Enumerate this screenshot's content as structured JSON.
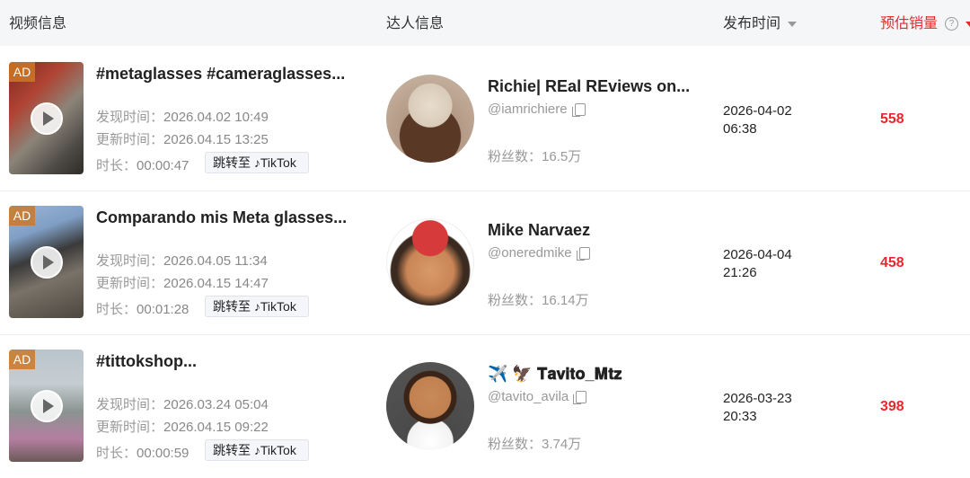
{
  "header": {
    "video_info": "视频信息",
    "creator_info": "达人信息",
    "publish_time": "发布时间",
    "est_sales": "预估销量"
  },
  "labels": {
    "found_prefix": "发现时间：",
    "updated_prefix": "更新时间：",
    "duration_prefix": "时长：",
    "jump_to": "跳转至",
    "tiktok": "TikTok",
    "fans_prefix": "粉丝数：",
    "ad": "AD"
  },
  "rows": [
    {
      "title": "#metaglasses #cameraglasses...",
      "found": "2026.04.02 10:49",
      "updated": "2026.04.15 13:25",
      "duration": "00:00:47",
      "creator_name": "Richie| REal REviews on...",
      "handle": "@iamrichiere",
      "fans": "16.5万",
      "pub_date": "2026-04-02",
      "pub_time": "06:38",
      "sales": "558"
    },
    {
      "title": "Comparando mis Meta glasses...",
      "found": "2026.04.05 11:34",
      "updated": "2026.04.15 14:47",
      "duration": "00:01:28",
      "creator_name": "Mike Narvaez",
      "handle": "@oneredmike",
      "fans": "16.14万",
      "pub_date": "2026-04-04",
      "pub_time": "21:26",
      "sales": "458"
    },
    {
      "title": "#tittokshop...",
      "found": "2026.03.24 05:04",
      "updated": "2026.04.15 09:22",
      "duration": "00:00:59",
      "creator_name": "✈️ 🦅 𝐓𝐚𝐯𝐢𝐭𝐨_𝐌𝐭𝐳",
      "handle": "@tavito_avila",
      "fans": "3.74万",
      "pub_date": "2026-03-23",
      "pub_time": "20:33",
      "sales": "398"
    }
  ]
}
